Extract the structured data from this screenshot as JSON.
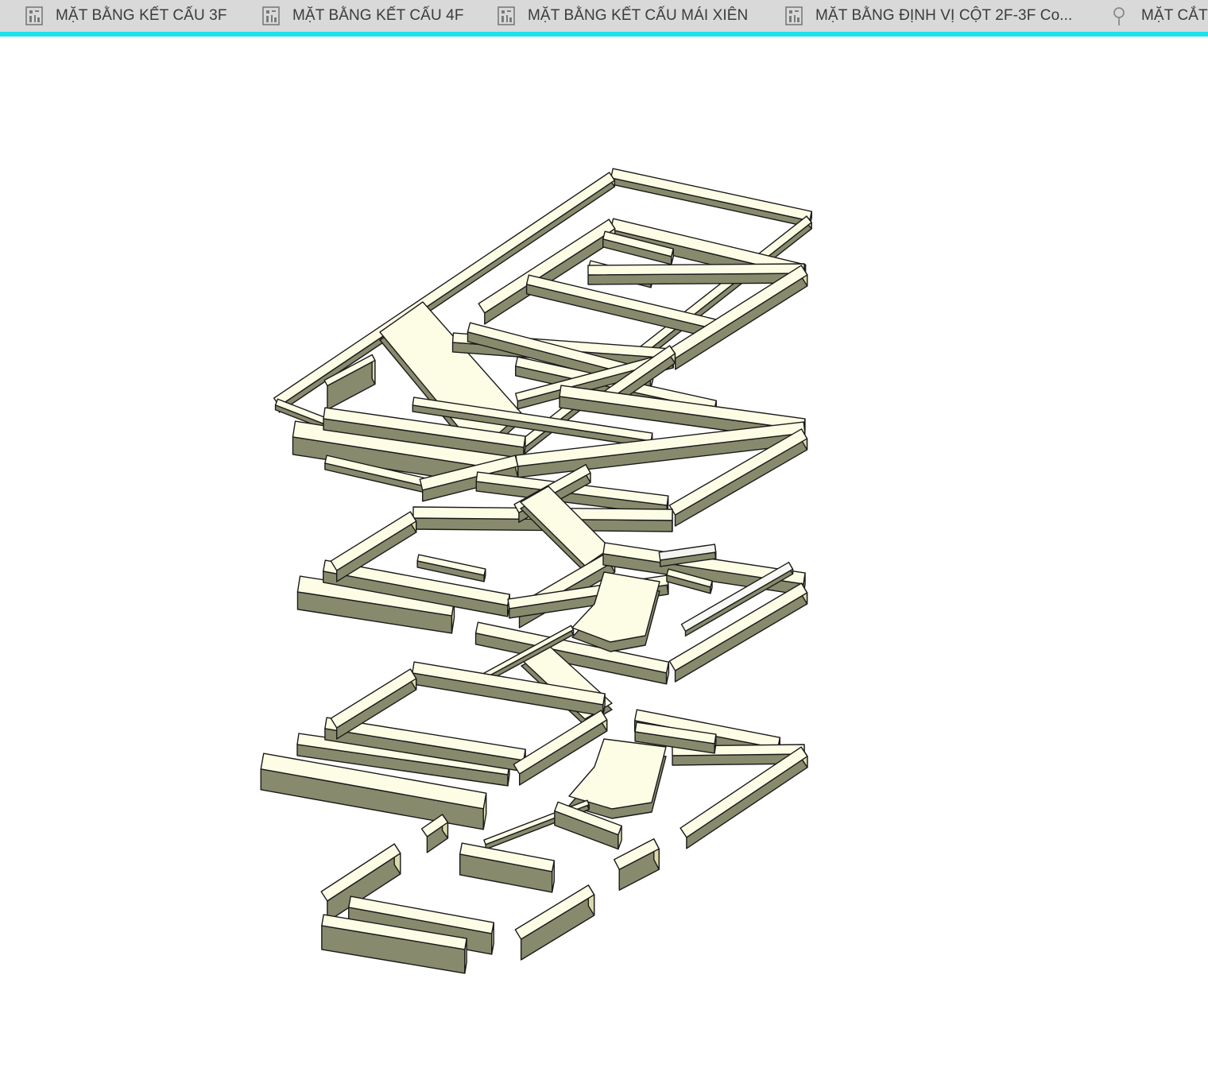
{
  "tabs": [
    {
      "label": "MẶT BẰNG KẾT CẤU 3F",
      "icon": "floor-plan-view-icon"
    },
    {
      "label": "MẶT BẰNG KẾT CẤU 4F",
      "icon": "floor-plan-view-icon"
    },
    {
      "label": "MẶT BẰNG KẾT CẤU MÁI XIÊN",
      "icon": "floor-plan-view-icon"
    },
    {
      "label": "MẶT BẰNG ĐỊNH VỊ CỘT 2F-3F Co...",
      "icon": "floor-plan-view-icon"
    },
    {
      "label": "MẶT CẮT",
      "icon": "section-view-icon"
    }
  ],
  "colors": {
    "accent": "#1fe1ec",
    "tab_bar": "#d9d9d9",
    "beam_top": "#fdfde6",
    "beam_side": "#dadba8",
    "beam_dark": "#878a6c",
    "edge": "#1a1a1a"
  }
}
